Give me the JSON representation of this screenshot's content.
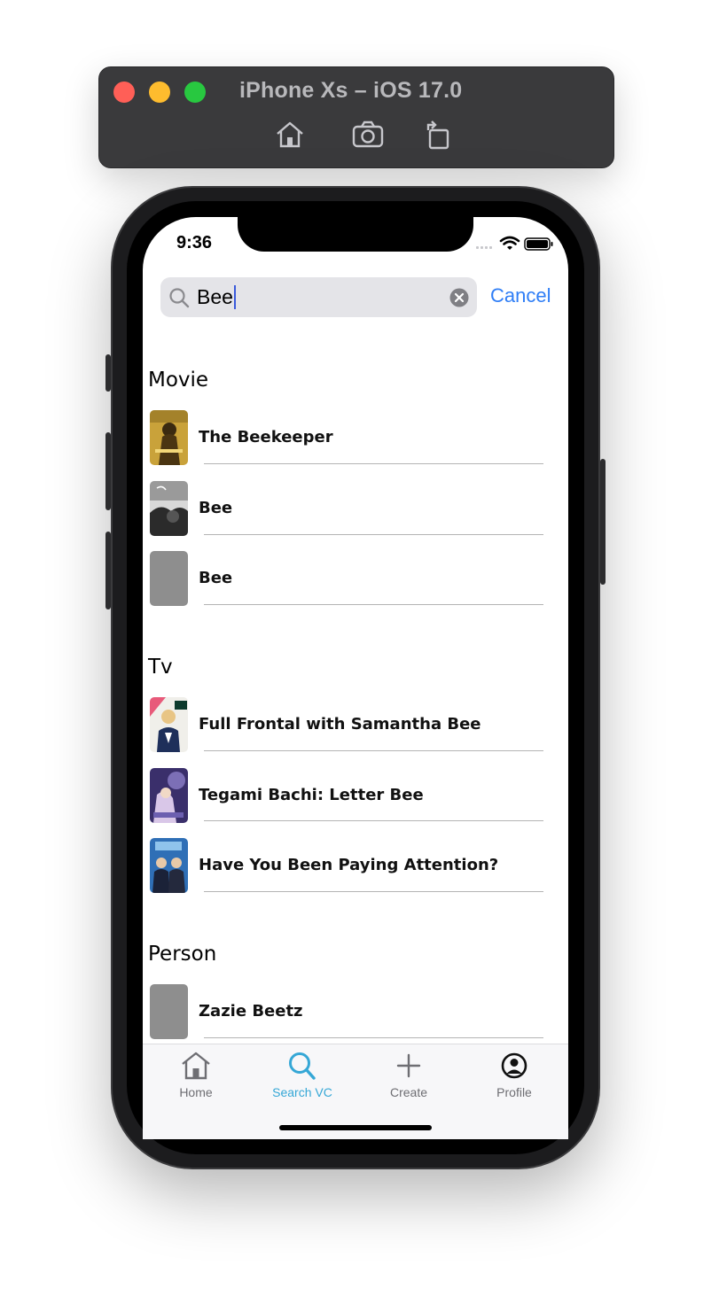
{
  "simulator": {
    "title": "iPhone Xs – iOS 17.0",
    "toolbar_icons": [
      "home-icon",
      "screenshot-icon",
      "rotate-icon"
    ]
  },
  "status_bar": {
    "time": "9:36"
  },
  "search": {
    "query": "Bee",
    "cancel_label": "Cancel"
  },
  "sections": [
    {
      "title": "Movie",
      "items": [
        {
          "title": "The Beekeeper",
          "thumb": "poster-beekeeper"
        },
        {
          "title": "Bee",
          "thumb": "poster-bee-bw"
        },
        {
          "title": "Bee",
          "thumb": "placeholder"
        }
      ]
    },
    {
      "title": "Tv",
      "items": [
        {
          "title": "Full Frontal with Samantha Bee",
          "thumb": "poster-full-frontal"
        },
        {
          "title": "Tegami Bachi: Letter Bee",
          "thumb": "poster-tegami-bachi"
        },
        {
          "title": "Have You Been Paying Attention?",
          "thumb": "poster-hybpa"
        }
      ]
    },
    {
      "title": "Person",
      "items": [
        {
          "title": "Zazie Beetz",
          "thumb": "placeholder"
        }
      ]
    }
  ],
  "tabbar": {
    "active": 1,
    "accent": "#35a7d6",
    "tabs": [
      {
        "label": "Home",
        "icon": "home-icon"
      },
      {
        "label": "Search VC",
        "icon": "search-icon"
      },
      {
        "label": "Create",
        "icon": "plus-icon"
      },
      {
        "label": "Profile",
        "icon": "profile-icon"
      }
    ]
  }
}
